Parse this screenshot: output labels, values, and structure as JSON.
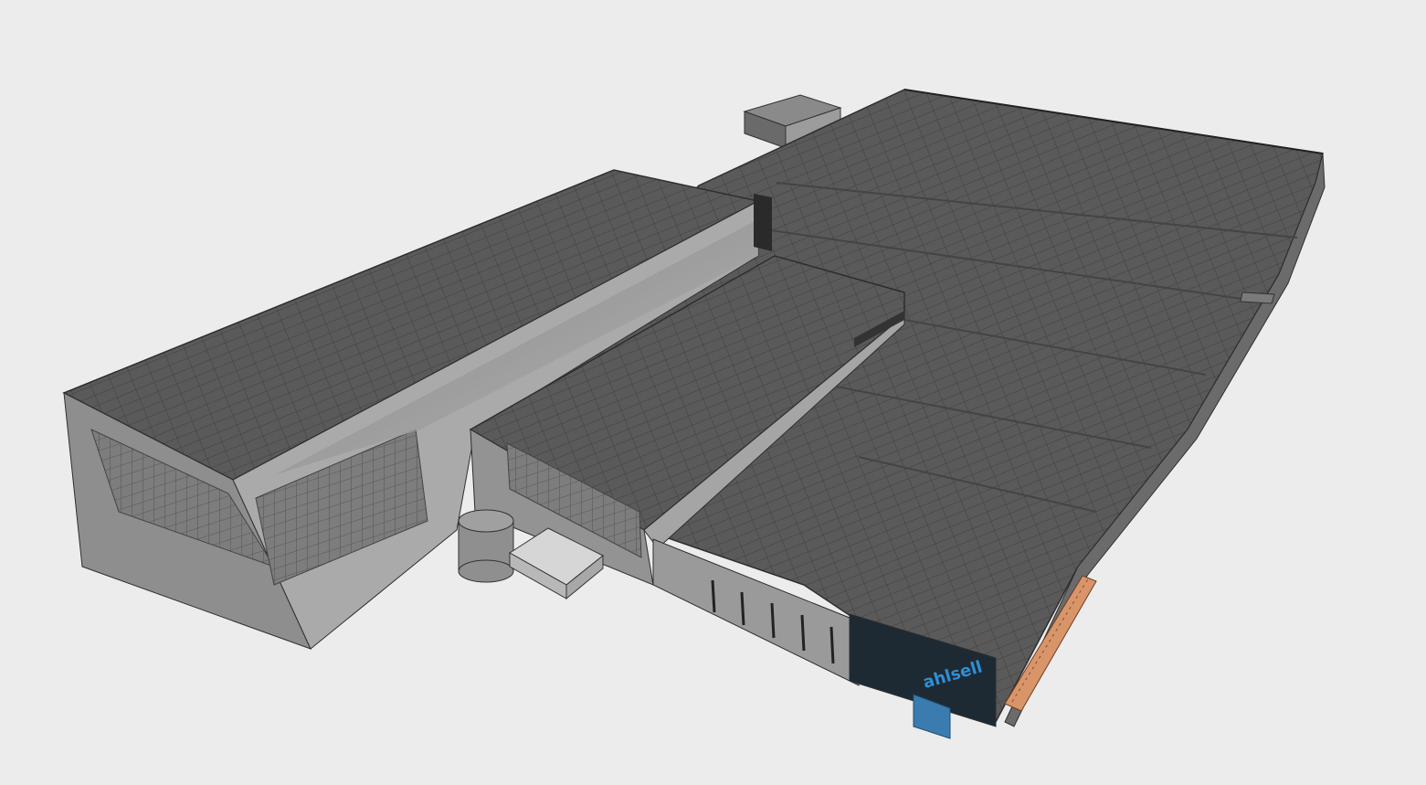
{
  "viewport": {
    "background": "#ececec"
  },
  "model": {
    "sign_text": "ahlsell",
    "colors": {
      "roof": "#5c5c5c",
      "roof_dark": "#4a4a4a",
      "wall_light": "#b3b3b3",
      "wall_mid": "#8f8f8f",
      "wall_dark": "#6e6e6e",
      "edge": "#2e2e2e",
      "sign": "#2f8fd4",
      "canopy": "#d9956a",
      "glass": "#1e2a33"
    }
  }
}
